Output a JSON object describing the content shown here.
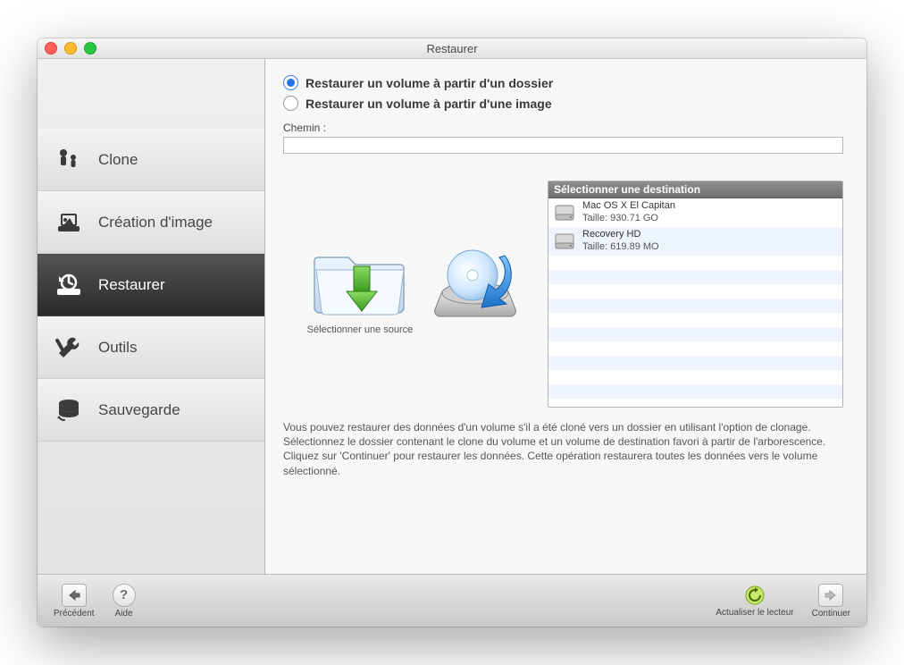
{
  "window": {
    "title": "Restaurer"
  },
  "sidebar": {
    "items": [
      {
        "label": "Clone"
      },
      {
        "label": "Création d'image"
      },
      {
        "label": "Restaurer"
      },
      {
        "label": "Outils"
      },
      {
        "label": "Sauvegarde"
      }
    ],
    "selected_index": 2
  },
  "options": {
    "from_folder": "Restaurer un volume à partir d'un dossier",
    "from_image": "Restaurer un volume à partir d'une image",
    "selected": "from_folder"
  },
  "path": {
    "label": "Chemin :",
    "value": ""
  },
  "source": {
    "caption": "Sélectionner une source"
  },
  "destination": {
    "header": "Sélectionner une destination",
    "items": [
      {
        "name": "Mac OS X El Capitan",
        "size": "Taille: 930.71 GO"
      },
      {
        "name": "Recovery HD",
        "size": "Taille: 619.89 MO"
      }
    ]
  },
  "help_text": "Vous pouvez restaurer des données d'un volume s'il a été cloné vers un dossier en utilisant l'option de clonage. Sélectionnez le dossier contenant le clone du volume et un volume de destination favori à partir de l'arborescence. Cliquez sur 'Continuer' pour restaurer les données. Cette opération restaurera toutes les données vers le volume sélectionné.",
  "footer": {
    "back": "Précédent",
    "help": "Aide",
    "refresh": "Actualiser le lecteur",
    "next": "Continuer"
  },
  "colors": {
    "accent": "#2573e6"
  }
}
